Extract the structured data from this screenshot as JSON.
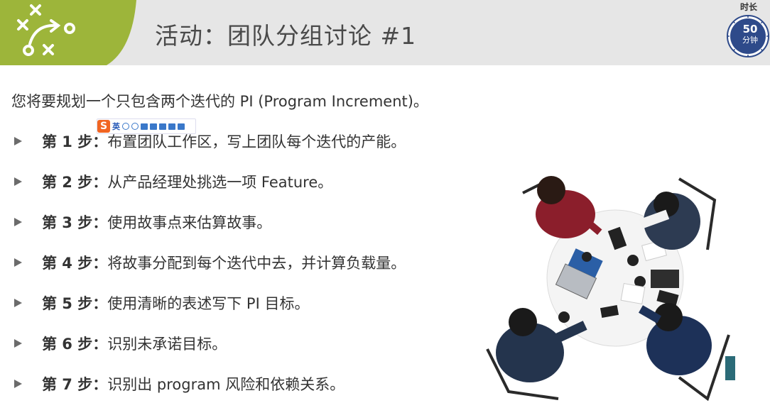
{
  "header": {
    "title": "活动：团队分组讨论 #1",
    "logo_icon": "strategy-play-icon",
    "accent_color": "#9db53a"
  },
  "duration": {
    "label": "时长",
    "value": "50",
    "unit": "分钟",
    "color": "#2e4a8a"
  },
  "intro": "您将要规划一个只包含两个迭代的 PI (Program Increment)。",
  "ime_toolbar": {
    "logo": "S",
    "lang": "英"
  },
  "steps": [
    {
      "label": "第 1 步：",
      "text": "布置团队工作区，写上团队每个迭代的产能。"
    },
    {
      "label": "第 2 步：",
      "text": "从产品经理处挑选一项 Feature。"
    },
    {
      "label": "第 3 步：",
      "text": "使用故事点来估算故事。"
    },
    {
      "label": "第 4 步：",
      "text": "将故事分配到每个迭代中去，并计算负载量。"
    },
    {
      "label": "第 5 步：",
      "text": "使用清晰的表述写下 PI 目标。"
    },
    {
      "label": "第 6 步：",
      "text": "识别未承诺目标。"
    },
    {
      "label": "第 7 步：",
      "text": "识别出 program 风险和依赖关系。"
    }
  ],
  "photo": {
    "subject": "team-meeting-photo"
  }
}
